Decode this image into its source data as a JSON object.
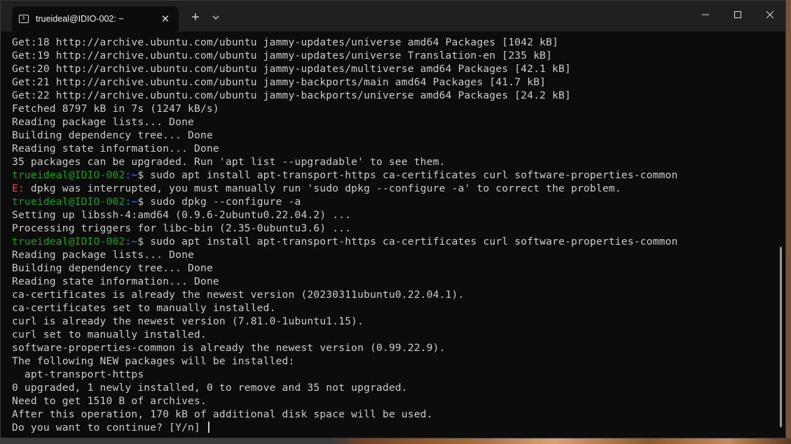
{
  "window": {
    "tab_title": "trueideal@IDIO-002: ~",
    "tab_icon": "terminal-icon",
    "new_tab_label": "+",
    "close_tab_label": "✕"
  },
  "colors": {
    "prompt_user": "#13a10e",
    "prompt_path": "#3b78ff",
    "error_prefix": "#e74856",
    "text": "#cccccc",
    "background": "#0c0c0c"
  },
  "terminal": {
    "lines": [
      {
        "text": "Get:18 http://archive.ubuntu.com/ubuntu jammy-updates/universe amd64 Packages [1042 kB]"
      },
      {
        "text": "Get:19 http://archive.ubuntu.com/ubuntu jammy-updates/universe Translation-en [235 kB]"
      },
      {
        "text": "Get:20 http://archive.ubuntu.com/ubuntu jammy-updates/multiverse amd64 Packages [42.1 kB]"
      },
      {
        "text": "Get:21 http://archive.ubuntu.com/ubuntu jammy-backports/main amd64 Packages [41.7 kB]"
      },
      {
        "text": "Get:22 http://archive.ubuntu.com/ubuntu jammy-backports/universe amd64 Packages [24.2 kB]"
      },
      {
        "text": "Fetched 8797 kB in 7s (1247 kB/s)"
      },
      {
        "text": "Reading package lists... Done"
      },
      {
        "text": "Building dependency tree... Done"
      },
      {
        "text": "Reading state information... Done"
      },
      {
        "text": "35 packages can be upgraded. Run 'apt list --upgradable' to see them."
      },
      {
        "prompt_user": "trueideal@IDIO-002",
        "prompt_path": ":~",
        "text": "$ sudo apt install apt-transport-https ca-certificates curl software-properties-common"
      },
      {
        "error_prefix": "E:",
        "text": " dpkg was interrupted, you must manually run 'sudo dpkg --configure -a' to correct the problem."
      },
      {
        "prompt_user": "trueideal@IDIO-002",
        "prompt_path": ":~",
        "text": "$ sudo dpkg --configure -a"
      },
      {
        "text": "Setting up libssh-4:amd64 (0.9.6-2ubuntu0.22.04.2) ..."
      },
      {
        "text": "Processing triggers for libc-bin (2.35-0ubuntu3.6) ..."
      },
      {
        "prompt_user": "trueideal@IDIO-002",
        "prompt_path": ":~",
        "text": "$ sudo apt install apt-transport-https ca-certificates curl software-properties-common"
      },
      {
        "text": "Reading package lists... Done"
      },
      {
        "text": "Building dependency tree... Done"
      },
      {
        "text": "Reading state information... Done"
      },
      {
        "text": "ca-certificates is already the newest version (20230311ubuntu0.22.04.1)."
      },
      {
        "text": "ca-certificates set to manually installed."
      },
      {
        "text": "curl is already the newest version (7.81.0-1ubuntu1.15)."
      },
      {
        "text": "curl set to manually installed."
      },
      {
        "text": "software-properties-common is already the newest version (0.99.22.9)."
      },
      {
        "text": "The following NEW packages will be installed:"
      },
      {
        "text": "  apt-transport-https"
      },
      {
        "text": "0 upgraded, 1 newly installed, 0 to remove and 35 not upgraded."
      },
      {
        "text": "Need to get 1510 B of archives."
      },
      {
        "text": "After this operation, 170 kB of additional disk space will be used."
      },
      {
        "text": "Do you want to continue? [Y/n] "
      }
    ]
  }
}
